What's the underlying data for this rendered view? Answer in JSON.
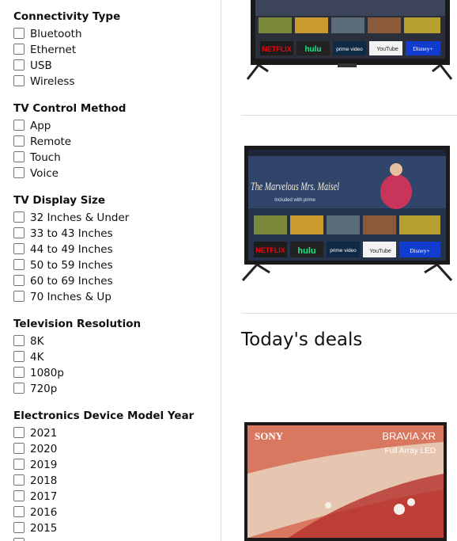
{
  "filters": [
    {
      "title": "Connectivity Type",
      "options": [
        "Bluetooth",
        "Ethernet",
        "USB",
        "Wireless"
      ]
    },
    {
      "title": "TV Control Method",
      "options": [
        "App",
        "Remote",
        "Touch",
        "Voice"
      ]
    },
    {
      "title": "TV Display Size",
      "options": [
        "32 Inches & Under",
        "33 to 43 Inches",
        "44 to 49 Inches",
        "50 to 59 Inches",
        "60 to 69 Inches",
        "70 Inches & Up"
      ]
    },
    {
      "title": "Television Resolution",
      "options": [
        "8K",
        "4K",
        "1080p",
        "720p"
      ]
    },
    {
      "title": "Electronics Device Model Year",
      "options": [
        "2021",
        "2020",
        "2019",
        "2018",
        "2017",
        "2016",
        "2015"
      ]
    }
  ],
  "results": {
    "deals_heading": "Today's deals"
  },
  "tv_screens": {
    "tv1": {
      "app_tiles": [
        "NETFLIX",
        "hulu",
        "prime video",
        "YouTube",
        "Disney+"
      ]
    },
    "tv2": {
      "show_title": "The Marvelous Mrs. Maisel",
      "show_tagline": "Included with prime",
      "app_tiles": [
        "NETFLIX",
        "hulu",
        "prime video",
        "YouTube",
        "Disney+"
      ]
    },
    "tv3": {
      "brand": "SONY",
      "model": "BRAVIA XR",
      "subline": "Full Array LED"
    }
  },
  "colors": {
    "netflix": "#e50914",
    "hulu": "#1ce783",
    "prime": "#00a8e1",
    "disney": "#113ccf",
    "tv_bezel": "#1a1a1a",
    "divider": "#dddddd"
  }
}
